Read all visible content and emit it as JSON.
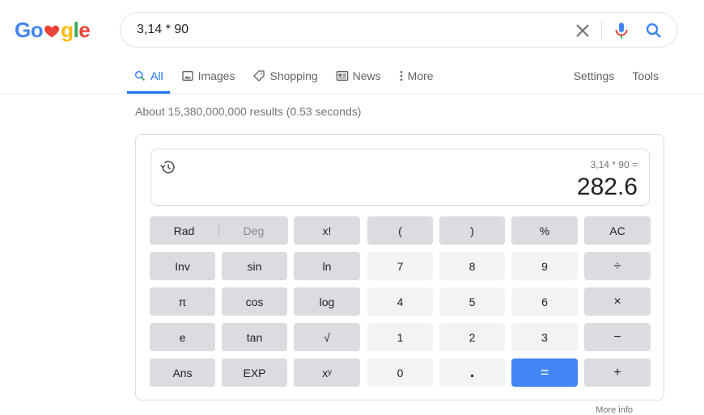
{
  "logo": {
    "text_before": "Go",
    "text_after": "gle"
  },
  "search": {
    "query": "3,14 * 90"
  },
  "tabs": [
    {
      "label": "All",
      "icon": "search-icon"
    },
    {
      "label": "Images",
      "icon": "image-icon"
    },
    {
      "label": "Shopping",
      "icon": "tag-icon"
    },
    {
      "label": "News",
      "icon": "news-icon"
    },
    {
      "label": "More",
      "icon": "more-vert-icon"
    }
  ],
  "right_tabs": {
    "settings": "Settings",
    "tools": "Tools"
  },
  "stats": "About 15,380,000,000 results (0.53 seconds)",
  "calculator": {
    "expression": "3,14 * 90 =",
    "result": "282.6",
    "rad": "Rad",
    "deg": "Deg",
    "keys": {
      "fact": "x!",
      "lparen": "(",
      "rparen": ")",
      "percent": "%",
      "ac": "AC",
      "inv": "Inv",
      "sin": "sin",
      "ln": "ln",
      "seven": "7",
      "eight": "8",
      "nine": "9",
      "divide": "÷",
      "pi": "π",
      "cos": "cos",
      "log": "log",
      "four": "4",
      "five": "5",
      "six": "6",
      "multiply": "×",
      "e": "e",
      "tan": "tan",
      "sqrt": "√",
      "one": "1",
      "two": "2",
      "three": "3",
      "minus": "−",
      "ans": "Ans",
      "exp": "EXP",
      "pow": "xʸ",
      "zero": "0",
      "dot": ".",
      "equals": "=",
      "plus": "+"
    }
  },
  "more_info": "More info",
  "colors": {
    "accent": "#1a73e8",
    "equals_key": "#4285f4",
    "function_key": "#dadce0",
    "number_key": "#f1f3f4"
  }
}
